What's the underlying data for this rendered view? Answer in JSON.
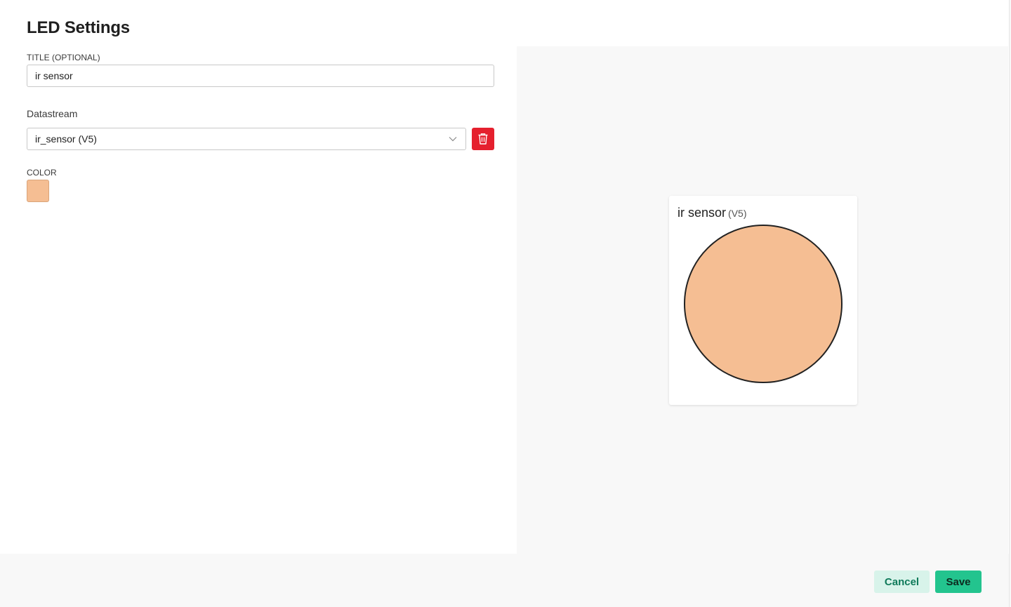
{
  "dialog": {
    "title": "LED Settings"
  },
  "settings": {
    "title_field": {
      "label": "TITLE (OPTIONAL)",
      "value": "ir sensor"
    },
    "datastream": {
      "label": "Datastream",
      "selected": "ir_sensor (V5)"
    },
    "color": {
      "label": "COLOR",
      "value": "#F5BE93"
    }
  },
  "preview": {
    "widget_title": "ir sensor",
    "widget_pin": "(V5)",
    "led_color": "#F5BE93"
  },
  "footer": {
    "cancel_label": "Cancel",
    "save_label": "Save"
  },
  "colors": {
    "accent": "#23C48E",
    "danger": "#E5202E",
    "cancel_bg": "#D8F3EA"
  },
  "icons": {
    "delete": "trash-icon",
    "dropdown": "chevron-down-icon"
  }
}
